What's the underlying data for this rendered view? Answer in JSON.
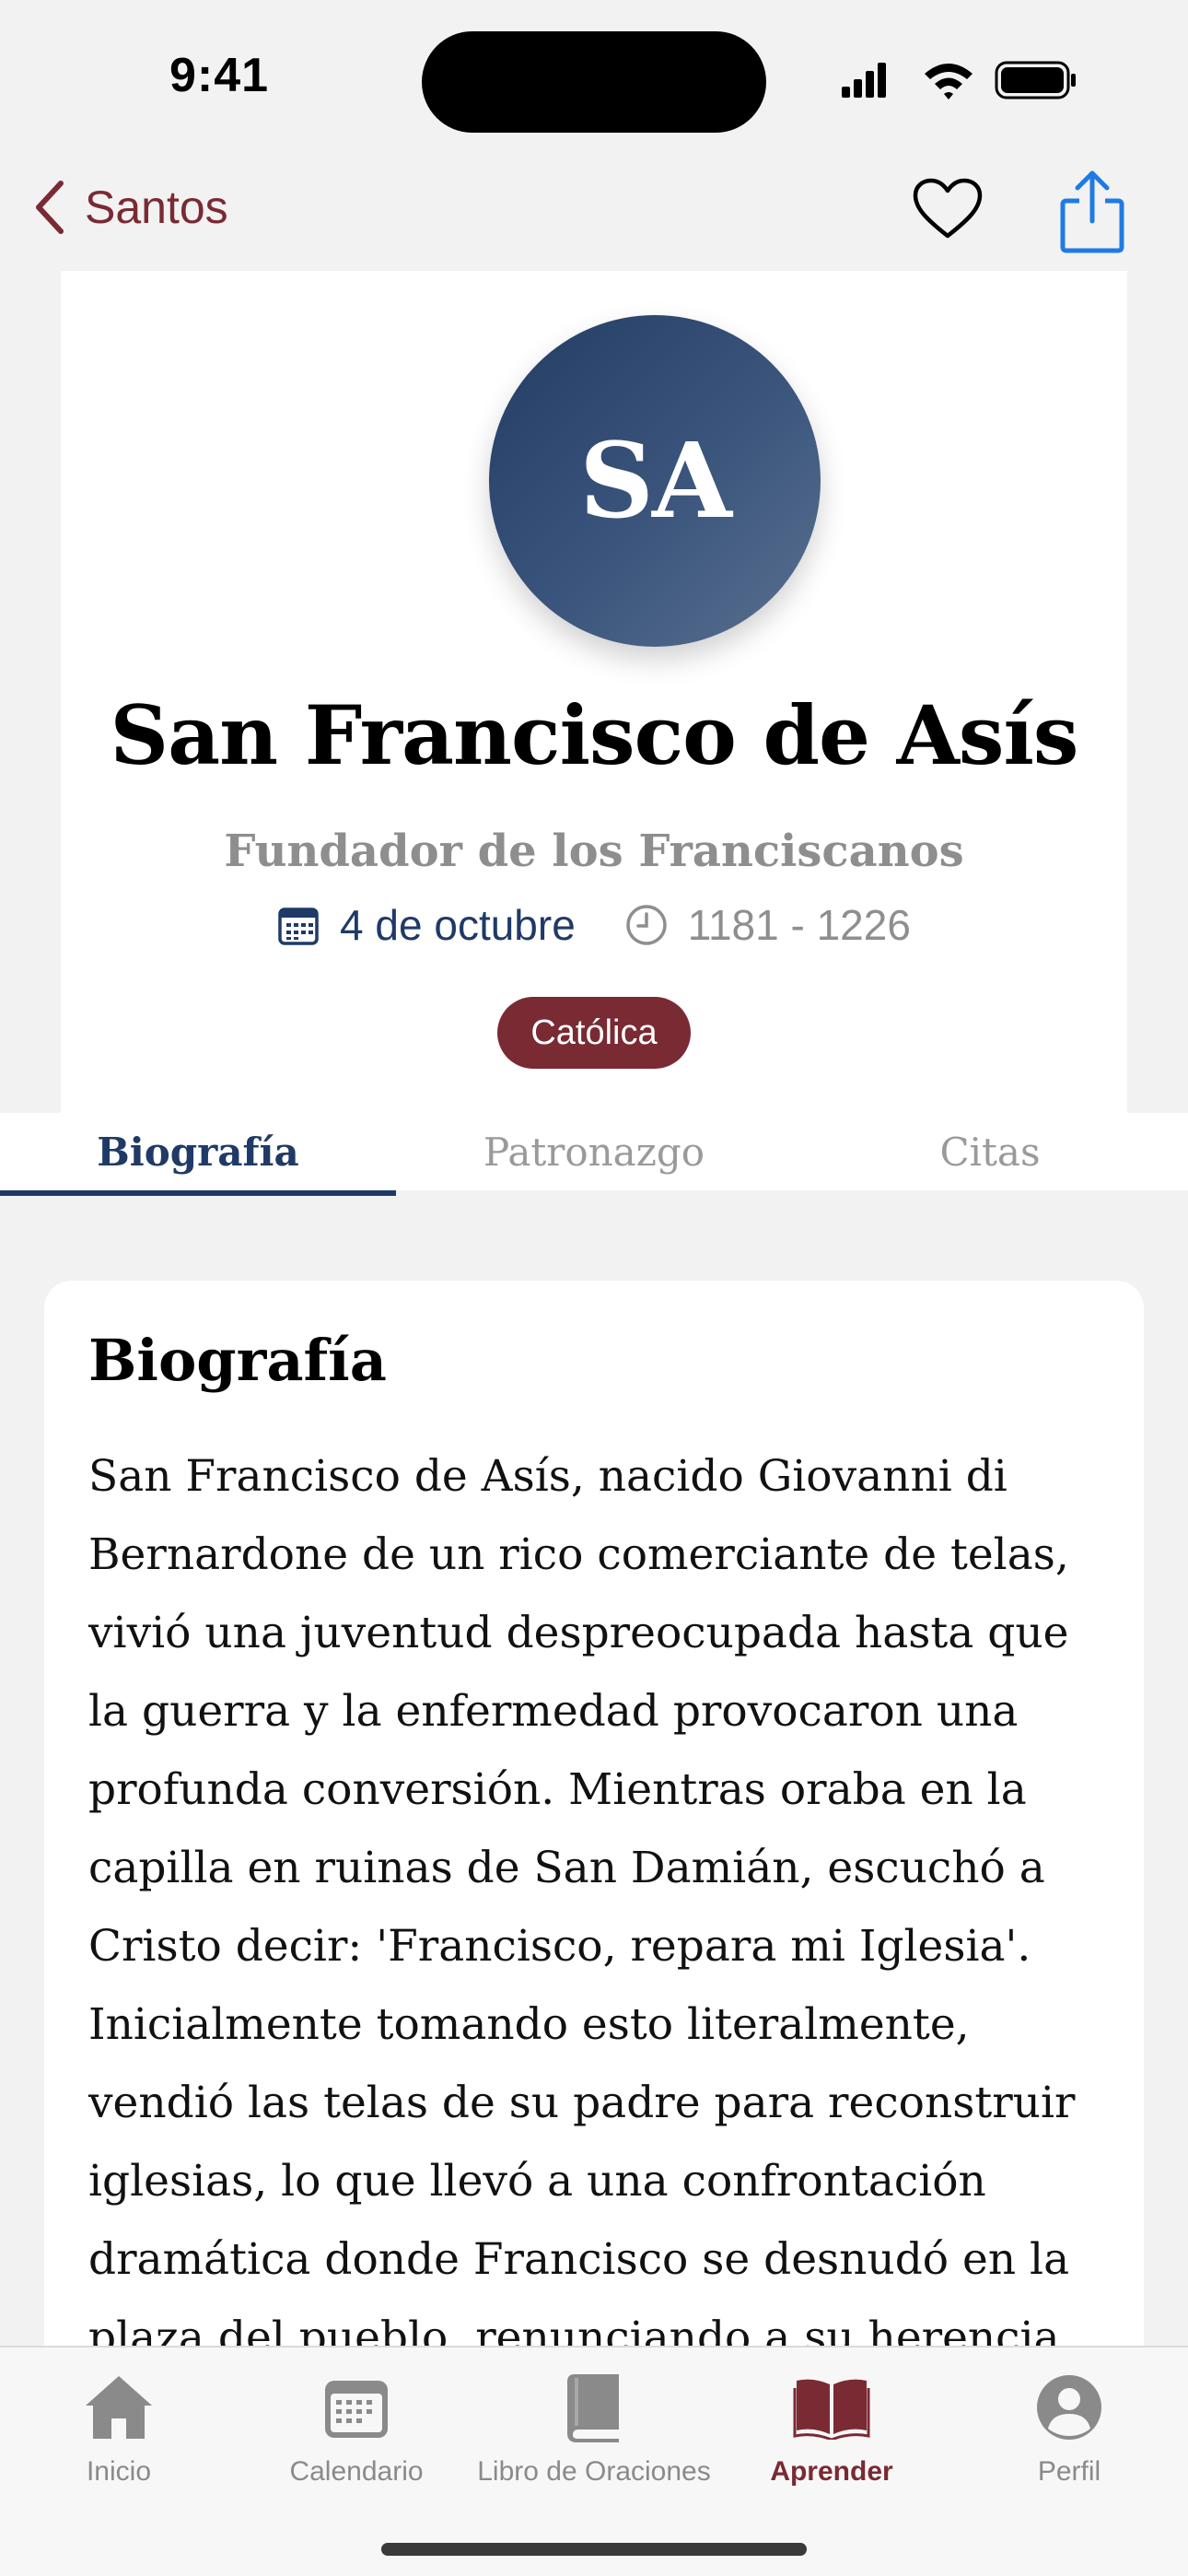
{
  "status_bar": {
    "time": "9:41",
    "icons": [
      "signal-icon",
      "wifi-icon",
      "battery-icon"
    ]
  },
  "nav": {
    "back_label": "Santos",
    "icons": [
      "chevron-left-icon",
      "heart-icon",
      "share-icon"
    ],
    "accent_color": "#7a2a33",
    "share_color": "#1e7be5"
  },
  "saint": {
    "initials": "SA",
    "name": "San Francisco de Asís",
    "subtitle": "Fundador de los Franciscanos",
    "feast_date": "4 de octubre",
    "years": "1181 - 1226",
    "tradition": "Católica",
    "avatar_color": "#2b4570"
  },
  "tabs": [
    {
      "label": "Biografía",
      "active": true
    },
    {
      "label": "Patronazgo",
      "active": false
    },
    {
      "label": "Citas",
      "active": false
    }
  ],
  "content": {
    "title": "Biografía",
    "body": "San Francisco de Asís, nacido Giovanni di Bernardone de un rico comerciante de telas, vivió una juventud despreocupada hasta que la guerra y la enfermedad provocaron una profunda conversión. Mientras oraba en la capilla en ruinas de San Damián, escuchó a Cristo decir: 'Francisco, repara mi Iglesia'. Inicialmente tomando esto literalmente, vendió las telas de su padre para reconstruir iglesias, lo que llevó a una confrontación dramática donde Francisco se desnudó en la plaza del pueblo, renunciando a su herencia."
  },
  "tab_bar": {
    "items": [
      {
        "label": "Inicio",
        "icon": "house-icon",
        "active": false
      },
      {
        "label": "Calendario",
        "icon": "calendar-icon",
        "active": false
      },
      {
        "label": "Libro de Oraciones",
        "icon": "book-icon",
        "active": false
      },
      {
        "label": "Aprender",
        "icon": "open-book-icon",
        "active": true
      },
      {
        "label": "Perfil",
        "icon": "person-icon",
        "active": false
      }
    ],
    "active_color": "#7a2a33",
    "inactive_color": "#8a8a8a"
  }
}
